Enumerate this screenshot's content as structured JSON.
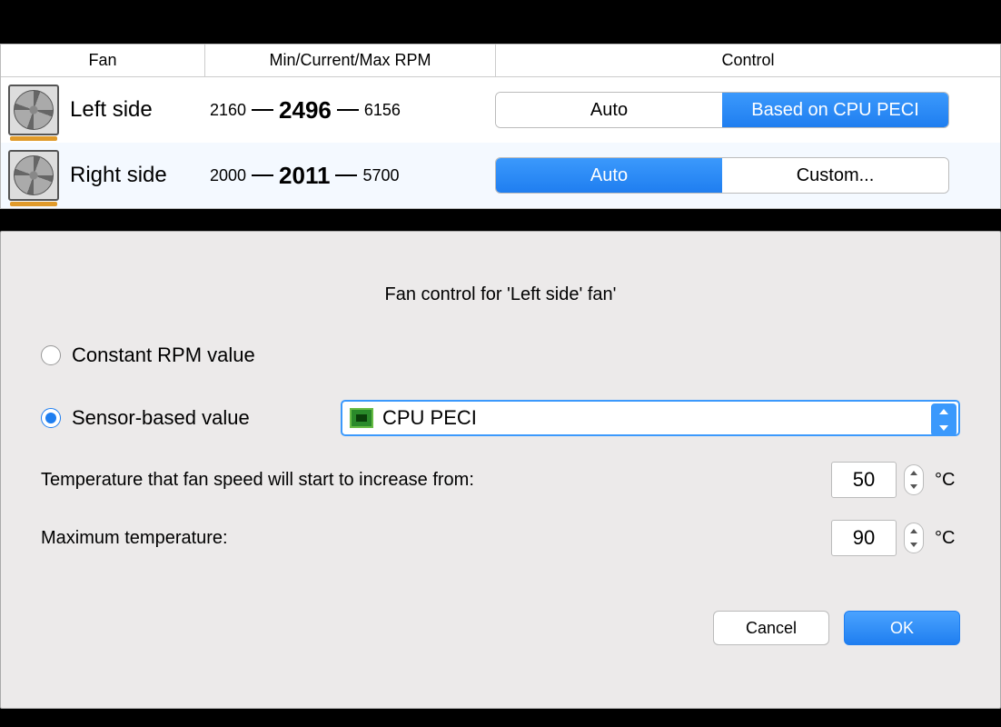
{
  "table": {
    "headers": {
      "fan": "Fan",
      "rpm": "Min/Current/Max RPM",
      "control": "Control"
    },
    "rows": [
      {
        "name": "Left side",
        "min": "2160",
        "cur": "2496",
        "max": "6156",
        "control": {
          "left": "Auto",
          "right": "Based on CPU PECI",
          "selected": "right"
        }
      },
      {
        "name": "Right side",
        "min": "2000",
        "cur": "2011",
        "max": "5700",
        "control": {
          "left": "Auto",
          "right": "Custom...",
          "selected": "left"
        }
      }
    ]
  },
  "dialog": {
    "title": "Fan control for 'Left side' fan'",
    "option_constant": "Constant RPM value",
    "option_sensor": "Sensor-based value",
    "sensor_selected": "CPU PECI",
    "temp_start_label": "Temperature that fan speed will start to increase from:",
    "temp_start_value": "50",
    "temp_max_label": "Maximum temperature:",
    "temp_max_value": "90",
    "unit": "°C",
    "cancel": "Cancel",
    "ok": "OK"
  }
}
